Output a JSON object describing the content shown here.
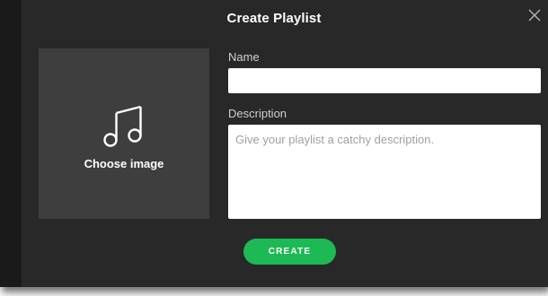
{
  "dialog": {
    "title": "Create Playlist",
    "close_icon": "close-icon"
  },
  "image_picker": {
    "icon": "music-note-icon",
    "label": "Choose image"
  },
  "form": {
    "name_label": "Name",
    "name_value": "",
    "description_label": "Description",
    "description_placeholder": "Give your playlist a catchy description.",
    "description_value": ""
  },
  "actions": {
    "create_label": "CREATE"
  },
  "colors": {
    "background": "#282828",
    "image_box": "#3e3e3e",
    "accent": "#1db954"
  }
}
